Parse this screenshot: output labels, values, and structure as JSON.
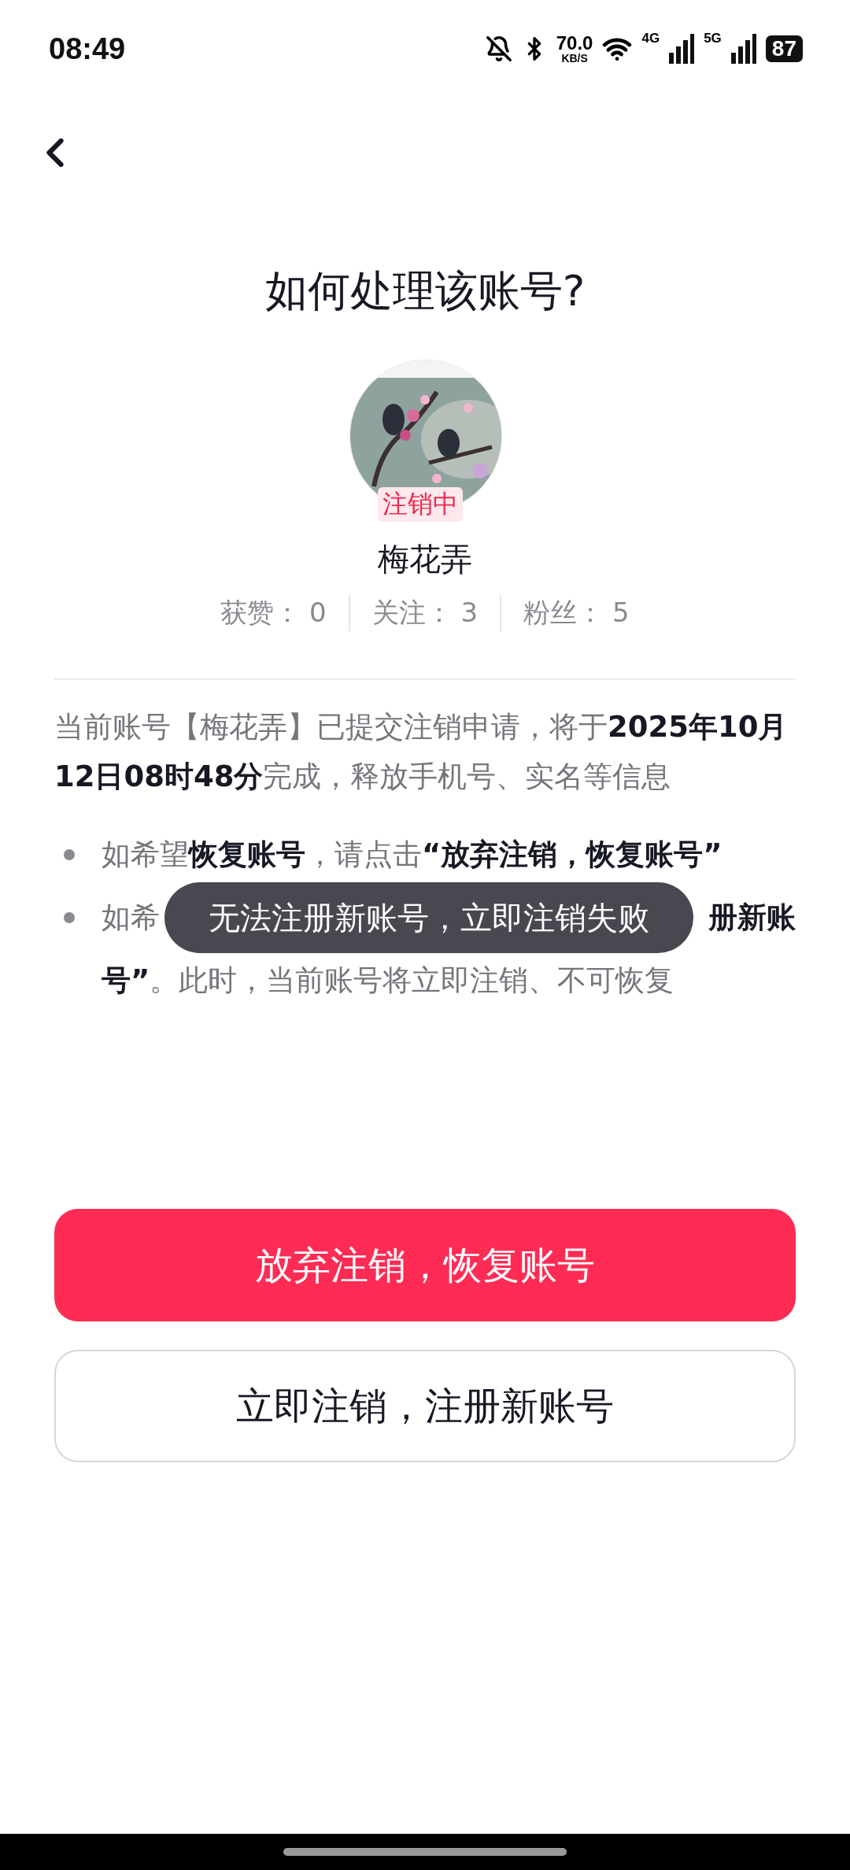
{
  "status_bar": {
    "time": "08:49",
    "speed_value": "70.0",
    "speed_unit": "KB/S",
    "networks": [
      "4G",
      "5G"
    ],
    "battery": "87"
  },
  "title": "如何处理该账号?",
  "profile": {
    "badge": "注销中",
    "name": "梅花弄",
    "stats": [
      {
        "label": "获赞：",
        "value": "0"
      },
      {
        "label": "关注：",
        "value": "3"
      },
      {
        "label": "粉丝：",
        "value": "5"
      }
    ]
  },
  "notice": "当前账号【梅花弄】已提交注销申请，将于**2025年10月12日08时48分**完成，释放手机号、实名等信息",
  "bullets": [
    {
      "kind": "full",
      "text": "如希望**恢复账号**，请点击**“放弃注销，恢复账号”**"
    },
    {
      "kind": "covered",
      "start": "如希",
      "end": "册新账",
      "rest": "**号”**。此时，当前账号将立即注销、不可恢复"
    }
  ],
  "toast": "无法注册新账号，立即注销失败",
  "buttons": [
    {
      "label": "放弃注销，恢复账号",
      "kind": "primary"
    },
    {
      "label": "立即注销，注册新账号",
      "kind": "outline"
    }
  ]
}
